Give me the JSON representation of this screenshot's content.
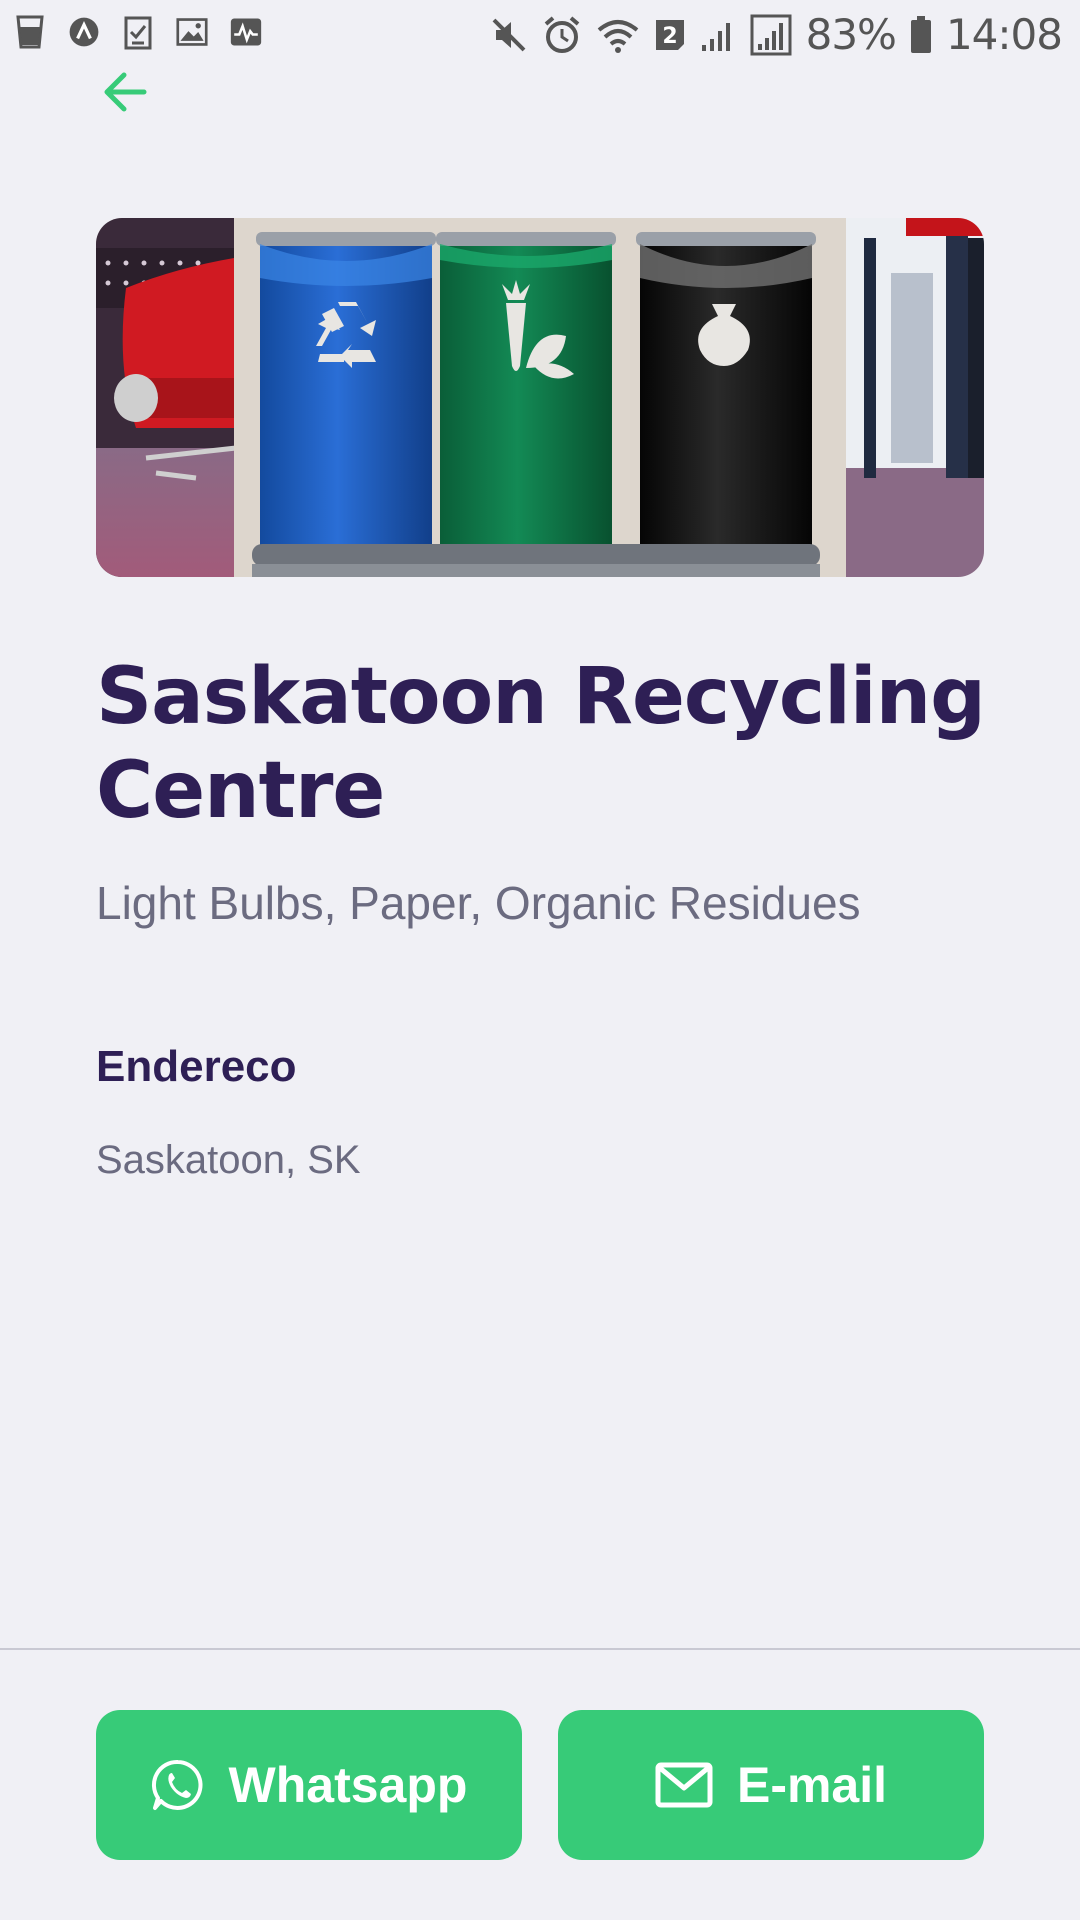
{
  "status_bar": {
    "left_icons": [
      "cup-icon",
      "a-letter-icon",
      "clipboard-check-icon",
      "image-icon",
      "activity-icon"
    ],
    "right_icons": [
      "mute-icon",
      "alarm-icon",
      "wifi-icon",
      "sim-2-icon",
      "signal-icon",
      "signal-icon-2",
      "battery-icon"
    ],
    "sim_badge": "2",
    "battery_percent": "83%",
    "time": "14:08"
  },
  "navigation": {
    "back_icon": "arrow-left-icon",
    "accent_color": "#37cb78"
  },
  "hero": {
    "description_icon": "recycling-bins-image",
    "bin_colors": [
      "#1f5fc4",
      "#0f7a4a",
      "#111111"
    ]
  },
  "centre": {
    "title": "Saskatoon Recycling Centre",
    "materials": "Light Bulbs, Paper, Organic Residues",
    "company": "Endereco",
    "location": "Saskatoon, SK"
  },
  "actions": {
    "whatsapp_label": "Whatsapp",
    "whatsapp_icon": "whatsapp-icon",
    "email_label": "E-mail",
    "email_icon": "mail-icon",
    "button_color": "#37cb78"
  },
  "colors": {
    "background": "#f0f0f5",
    "title": "#2e1f55",
    "secondary_text": "#6b6b80"
  }
}
